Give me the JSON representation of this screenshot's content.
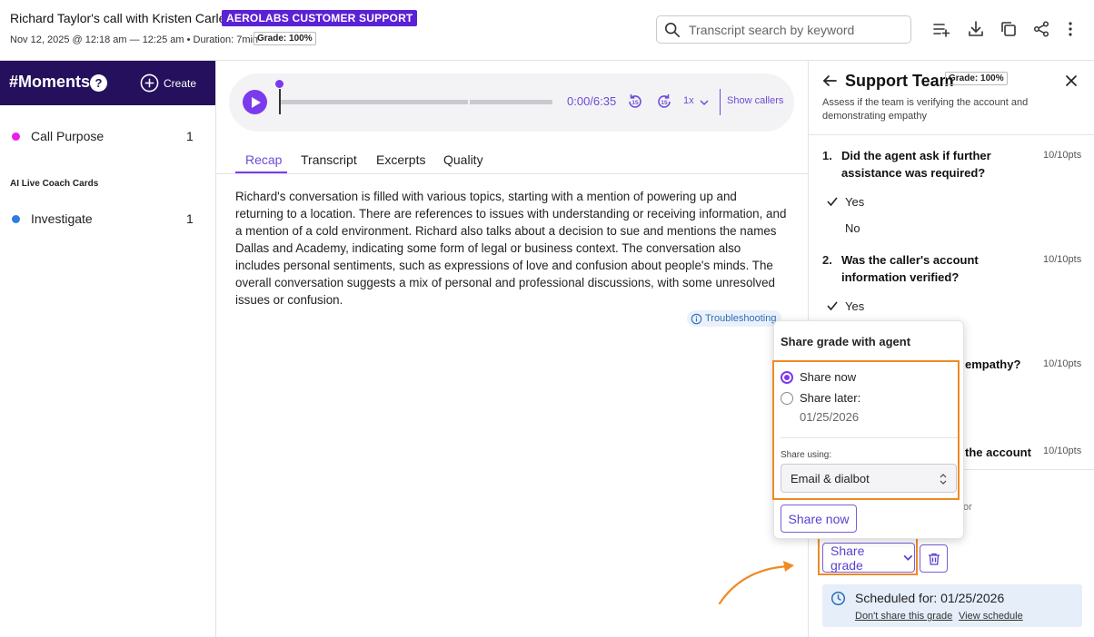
{
  "header": {
    "call_title": "Richard Taylor's call with Kristen Carlel",
    "team_badge": "AEROLABS CUSTOMER SUPPORT",
    "call_meta": "Nov 12, 2025 @ 12:18 am — 12:25 am • Duration: 7min",
    "grade": "Grade: 100%",
    "search_placeholder": "Transcript search by keyword",
    "icons": [
      "search-icon",
      "add-to-playlist-icon",
      "download-icon",
      "copy-icon",
      "share-icon",
      "more-vertical-icon"
    ]
  },
  "sidebar": {
    "title": "#Moments",
    "help": "?",
    "create_label": "Create",
    "moments": [
      {
        "label": "Call Purpose",
        "count": "1",
        "color": "#e91ee8"
      }
    ],
    "ai_cards_heading": "AI Live Coach Cards",
    "ai_cards": [
      {
        "label": "Investigate",
        "count": "1",
        "color": "#2d7be5"
      }
    ]
  },
  "player": {
    "time": "0:00/6:35",
    "speed": "1x",
    "show_callers": "Show callers",
    "accent": "#7c3aed"
  },
  "tabs": [
    "Recap",
    "Transcript",
    "Excerpts",
    "Quality"
  ],
  "active_tab": "Recap",
  "recap": {
    "text": "Richard's conversation is filled with various topics, starting with a mention of powering up and returning to a location. There are references to issues with understanding or receiving information, and a mention of a cold environment. Richard also talks about a decision to sue and mentions the names Dallas and Academy, indicating some form of legal or business context. The conversation also includes personal sentiments, such as expressions of love and confusion about people's minds. The overall conversation suggests a mix of personal and professional discussions, with some unresolved issues or confusion.",
    "chip": "Troubleshooting"
  },
  "panel": {
    "title": "Support Team",
    "grade": "Grade: 100%",
    "description": "Assess if the team is verifying the account and demonstrating empathy",
    "questions": [
      {
        "num": "1.",
        "text": "Did the agent ask if further assistance was required?",
        "pts": "10/10pts",
        "options": [
          "Yes",
          "No"
        ]
      },
      {
        "num": "2.",
        "text": "Was the caller's account information verified?",
        "pts": "10/10pts",
        "options": [
          "Yes"
        ]
      },
      {
        "text_tail": "empathy?",
        "pts": "10/10pts"
      },
      {
        "text_tail": "the account",
        "pts": "10/10pts"
      }
    ],
    "hidden_fragment": "or",
    "share_grade_label": "Share grade",
    "schedule": {
      "text": "Scheduled for: 01/25/2026",
      "dont_share": "Don't share this grade",
      "view_schedule": "View schedule"
    }
  },
  "popover": {
    "title": "Share grade with agent",
    "share_now_option": "Share now",
    "share_later_option": "Share later:",
    "share_later_date": "01/25/2026",
    "share_using_label": "Share using:",
    "share_using_value": "Email & dialbot",
    "submit_label": "Share now"
  },
  "colors": {
    "brand_purple": "#5b21d6",
    "sidebar_bg": "#24105c",
    "highlight_orange": "#f08a24",
    "schedule_bg": "#e6eefa"
  }
}
